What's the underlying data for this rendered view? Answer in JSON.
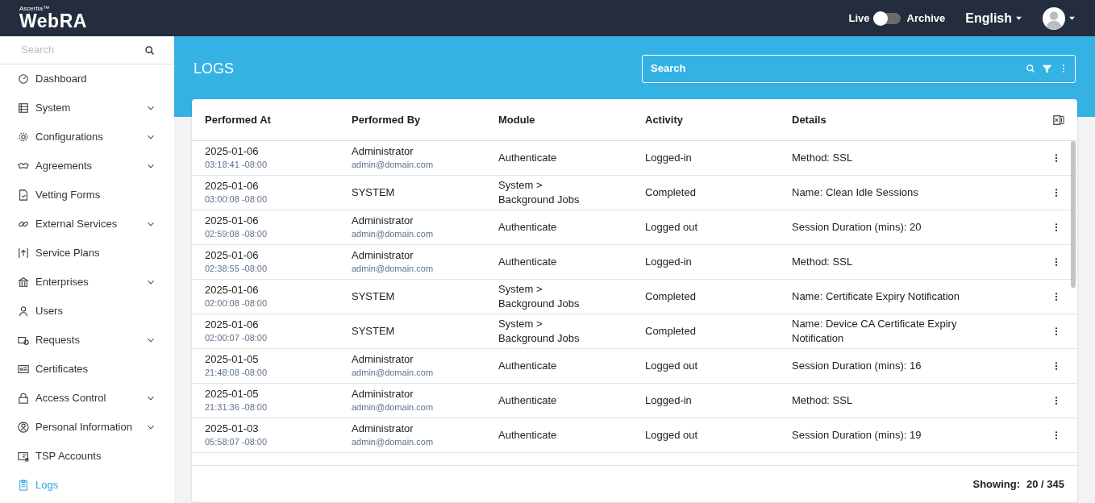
{
  "header": {
    "brand_small": "Ascertia™",
    "brand": "WebRA",
    "toggle": {
      "left_label": "Live",
      "right_label": "Archive",
      "on": false
    },
    "language": "English"
  },
  "sidebar": {
    "search": {
      "placeholder": "Search"
    },
    "items": [
      {
        "label": "Dashboard",
        "expandable": false,
        "selected": false
      },
      {
        "label": "System",
        "expandable": true,
        "selected": false
      },
      {
        "label": "Configurations",
        "expandable": true,
        "selected": false
      },
      {
        "label": "Agreements",
        "expandable": true,
        "selected": false
      },
      {
        "label": "Vetting Forms",
        "expandable": false,
        "selected": false
      },
      {
        "label": "External Services",
        "expandable": true,
        "selected": false
      },
      {
        "label": "Service Plans",
        "expandable": false,
        "selected": false
      },
      {
        "label": "Enterprises",
        "expandable": true,
        "selected": false
      },
      {
        "label": "Users",
        "expandable": false,
        "selected": false
      },
      {
        "label": "Requests",
        "expandable": true,
        "selected": false
      },
      {
        "label": "Certificates",
        "expandable": false,
        "selected": false
      },
      {
        "label": "Access Control",
        "expandable": true,
        "selected": false
      },
      {
        "label": "Personal Information",
        "expandable": true,
        "selected": false
      },
      {
        "label": "TSP Accounts",
        "expandable": false,
        "selected": false
      },
      {
        "label": "Logs",
        "expandable": false,
        "selected": true
      }
    ]
  },
  "page": {
    "title": "LOGS",
    "search": {
      "placeholder": "Search"
    }
  },
  "table": {
    "columns": [
      "Performed At",
      "Performed By",
      "Module",
      "Activity",
      "Details"
    ],
    "rows": [
      {
        "date": "2025-01-06",
        "time": "03:18:41 -08:00",
        "by": "Administrator",
        "email": "admin@domain.com",
        "module": "Authenticate",
        "activity": "Logged-in",
        "details": "Method: SSL"
      },
      {
        "date": "2025-01-06",
        "time": "03:00:08 -08:00",
        "by": "SYSTEM",
        "module": "System > Background Jobs",
        "activity": "Completed",
        "details": "Name: Clean Idle Sessions"
      },
      {
        "date": "2025-01-06",
        "time": "02:59:08 -08:00",
        "by": "Administrator",
        "email": "admin@domain.com",
        "module": "Authenticate",
        "activity": "Logged out",
        "details": "Session Duration (mins): 20"
      },
      {
        "date": "2025-01-06",
        "time": "02:38:55 -08:00",
        "by": "Administrator",
        "email": "admin@domain.com",
        "module": "Authenticate",
        "activity": "Logged-in",
        "details": "Method: SSL"
      },
      {
        "date": "2025-01-06",
        "time": "02:00:08 -08:00",
        "by": "SYSTEM",
        "module": "System > Background Jobs",
        "activity": "Completed",
        "details": "Name: Certificate Expiry Notification"
      },
      {
        "date": "2025-01-06",
        "time": "02:00:07 -08:00",
        "by": "SYSTEM",
        "module": "System > Background Jobs",
        "activity": "Completed",
        "details": "Name: Device CA Certificate Expiry Notification"
      },
      {
        "date": "2025-01-05",
        "time": "21:48:08 -08:00",
        "by": "Administrator",
        "email": "admin@domain.com",
        "module": "Authenticate",
        "activity": "Logged out",
        "details": "Session Duration (mins): 16"
      },
      {
        "date": "2025-01-05",
        "time": "21:31:36 -08:00",
        "by": "Administrator",
        "email": "admin@domain.com",
        "module": "Authenticate",
        "activity": "Logged-in",
        "details": "Method: SSL"
      },
      {
        "date": "2025-01-03",
        "time": "05:58:07 -08:00",
        "by": "Administrator",
        "email": "admin@domain.com",
        "module": "Authenticate",
        "activity": "Logged out",
        "details": "Session Duration (mins): 19"
      }
    ],
    "footer": {
      "label": "Showing:",
      "value": "20 / 345"
    }
  }
}
